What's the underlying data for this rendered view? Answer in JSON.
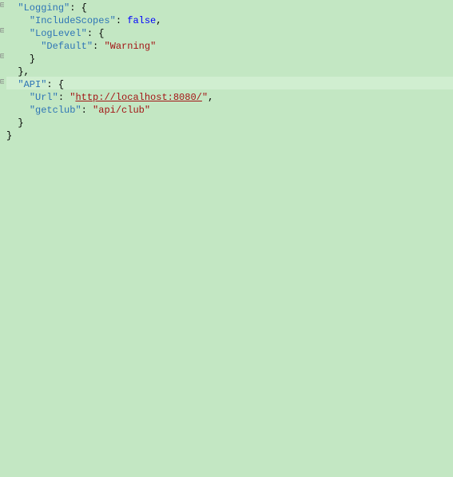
{
  "colors": {
    "background": "#c3e7c3",
    "highlight": "#d0eed0",
    "key": "#2e75b6",
    "punct": "#000000",
    "bool": "#0000ff",
    "string": "#a31515"
  },
  "gutter": {
    "glyph": "⊟",
    "visible_rows": [
      1,
      3,
      5,
      7
    ]
  },
  "code": {
    "line1": {
      "indent": "  ",
      "key_q": "\"",
      "key": "Logging",
      "key_q2": "\"",
      "colon": ": ",
      "brace": "{"
    },
    "line2": {
      "indent": "    ",
      "key_q": "\"",
      "key": "IncludeScopes",
      "key_q2": "\"",
      "colon": ": ",
      "value": "false",
      "comma": ","
    },
    "line3": {
      "indent": "    ",
      "key_q": "\"",
      "key": "LogLevel",
      "key_q2": "\"",
      "colon": ": ",
      "brace": "{"
    },
    "line4": {
      "indent": "      ",
      "key_q": "\"",
      "key": "Default",
      "key_q2": "\"",
      "colon": ": ",
      "val_q": "\"",
      "value": "Warning",
      "val_q2": "\""
    },
    "line5": {
      "indent": "    ",
      "brace": "}"
    },
    "line6": {
      "indent": "  ",
      "brace": "}",
      "comma": ","
    },
    "line7": {
      "indent": "  ",
      "key_q": "\"",
      "key": "API",
      "key_q2": "\"",
      "colon": ": ",
      "brace": "{"
    },
    "line8": {
      "indent": "    ",
      "key_q": "\"",
      "key": "Url",
      "key_q2": "\"",
      "colon": ": ",
      "val_q": "\"",
      "value": "http://localhost:8080/",
      "val_q2": "\"",
      "comma": ","
    },
    "line9": {
      "indent": "    ",
      "key_q": "\"",
      "key": "getclub",
      "key_q2": "\"",
      "colon": ": ",
      "val_q": "\"",
      "value": "api/club",
      "val_q2": "\""
    },
    "line10": {
      "indent": "  ",
      "brace": "}"
    },
    "line11": {
      "indent": "",
      "brace": "}"
    }
  }
}
